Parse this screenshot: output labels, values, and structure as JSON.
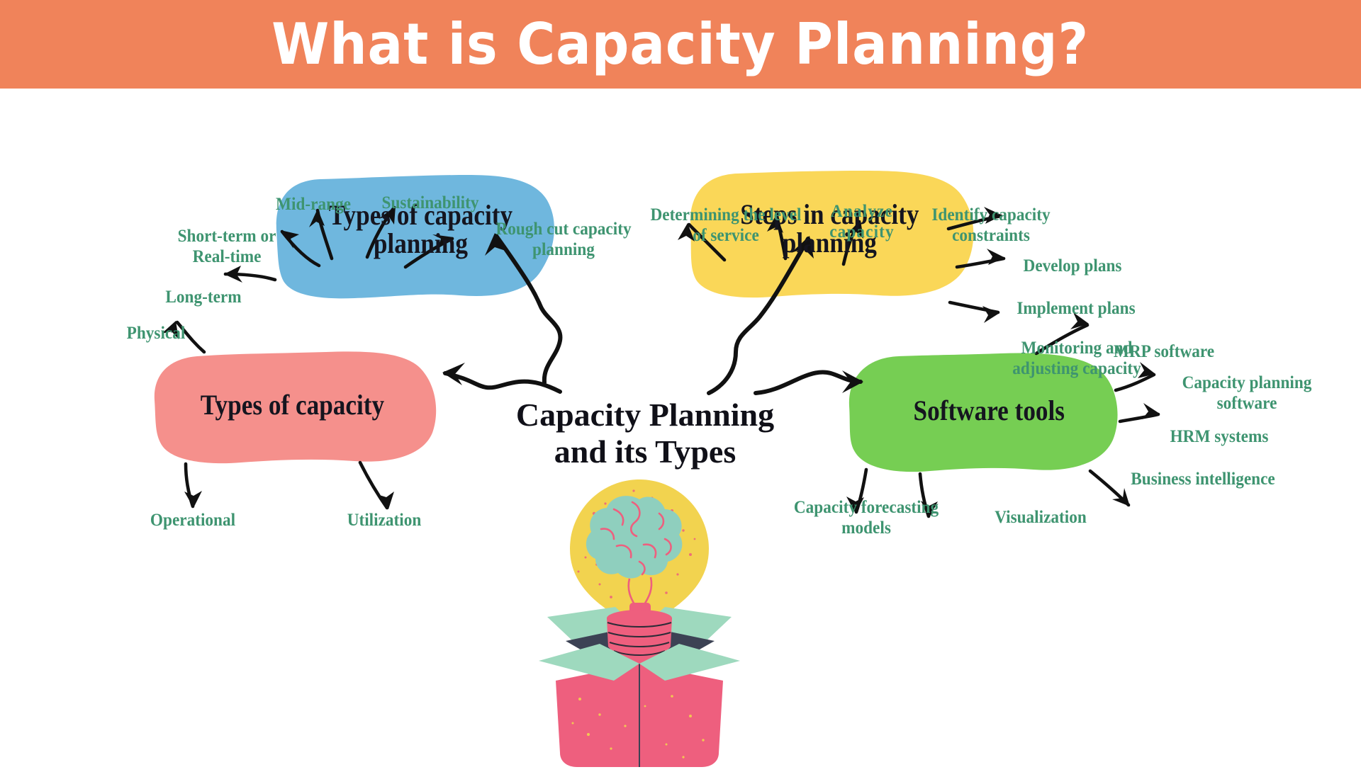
{
  "header": {
    "title": "What is Capacity Planning?",
    "background_color": "#F0835A",
    "text_color": "#FFFFFF"
  },
  "center": {
    "title_line1": "Capacity Planning",
    "title_line2": "and its Types",
    "illustration_name": "lightbulb-brain-in-box-illustration"
  },
  "palette": {
    "blue_node": "#6FB7DE",
    "yellow_node": "#FAD758",
    "pink_node": "#F5908C",
    "green_node": "#76CE53",
    "leaf_text": "#3E9470",
    "node_text": "#15151F",
    "connector": "#111111",
    "canvas": "#FFFFFF"
  },
  "branches": [
    {
      "id": "types-of-capacity-planning",
      "label_line1": "Types of capacity",
      "label_line2": "planning",
      "color": "#6FB7DE",
      "leaves": [
        {
          "id": "short-term-or-real-time",
          "line1": "Short-term or",
          "line2": "Real-time"
        },
        {
          "id": "mid-range",
          "line1": "Mid-range",
          "line2": ""
        },
        {
          "id": "sustainability",
          "line1": "Sustainability",
          "line2": ""
        },
        {
          "id": "rough-cut-capacity-planning",
          "line1": "Rough cut capacity",
          "line2": "planning"
        },
        {
          "id": "long-term",
          "line1": "Long-term",
          "line2": ""
        }
      ]
    },
    {
      "id": "steps-in-capacity-planning",
      "label_line1": "Steps in capacity",
      "label_line2": "planning",
      "color": "#FAD758",
      "leaves": [
        {
          "id": "determining-the-level-of-service",
          "line1": "Determining the level",
          "line2": "of service"
        },
        {
          "id": "analyze-capacity",
          "line1": "Analyze",
          "line2": "capacity"
        },
        {
          "id": "identify-capacity-constraints",
          "line1": "Identify  capacity",
          "line2": "constraints"
        },
        {
          "id": "develop-plans",
          "line1": "Develop  plans",
          "line2": ""
        },
        {
          "id": "implement-plans",
          "line1": "Implement plans",
          "line2": ""
        },
        {
          "id": "monitoring-and-adjusting-capacity",
          "line1": "Monitoring and",
          "line2": "adjusting capacity"
        }
      ]
    },
    {
      "id": "types-of-capacity",
      "label_line1": "Types of capacity",
      "label_line2": "",
      "color": "#F5908C",
      "leaves": [
        {
          "id": "physical",
          "line1": "Physical",
          "line2": ""
        },
        {
          "id": "operational",
          "line1": "Operational",
          "line2": ""
        },
        {
          "id": "utilization",
          "line1": "Utilization",
          "line2": ""
        }
      ]
    },
    {
      "id": "software-tools",
      "label_line1": "Software tools",
      "label_line2": "",
      "color": "#76CE53",
      "leaves": [
        {
          "id": "mrp-software",
          "line1": "MRP software",
          "line2": ""
        },
        {
          "id": "capacity-planning-software",
          "line1": "Capacity planning",
          "line2": "software"
        },
        {
          "id": "hrm-systems",
          "line1": "HRM systems",
          "line2": ""
        },
        {
          "id": "business-intelligence",
          "line1": "Business intelligence",
          "line2": ""
        },
        {
          "id": "visualization",
          "line1": "Visualization",
          "line2": ""
        },
        {
          "id": "capacity-forecasting-models",
          "line1": "Capacity forecasting",
          "line2": "models"
        }
      ]
    }
  ]
}
